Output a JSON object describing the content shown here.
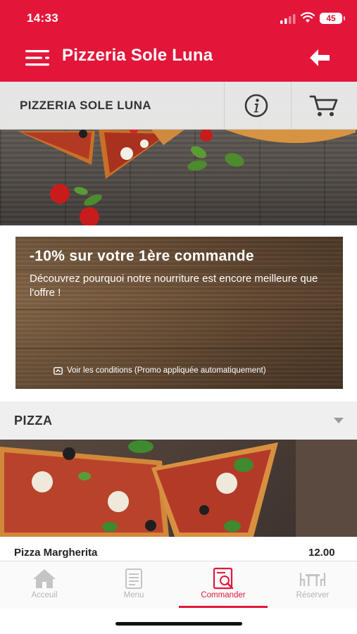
{
  "status_bar": {
    "time": "14:33",
    "battery": "45"
  },
  "app_bar": {
    "title": "Pizzeria Sole Luna"
  },
  "restaurant_band": {
    "name": "PIZZERIA SOLE LUNA"
  },
  "promo": {
    "title": "-10% sur votre 1ère commande",
    "description": "Découvrez pourquoi notre nourriture est encore meilleure que l'offre !",
    "conditions": "Voir les conditions (Promo appliquée automatiquement)"
  },
  "category": {
    "name": "PIZZA"
  },
  "menu_items": [
    {
      "name": "Pizza Margherita",
      "price": "12.00"
    }
  ],
  "tabs": [
    {
      "label": "Acceuil",
      "icon": "home-icon",
      "active": false
    },
    {
      "label": "Menu",
      "icon": "menu-book-icon",
      "active": false
    },
    {
      "label": "Commander",
      "icon": "order-icon",
      "active": true
    },
    {
      "label": "Réserver",
      "icon": "table-icon",
      "active": false
    }
  ],
  "colors": {
    "brand": "#e3163a",
    "tab_inactive": "#b4b4b4",
    "band": "#efefef"
  }
}
